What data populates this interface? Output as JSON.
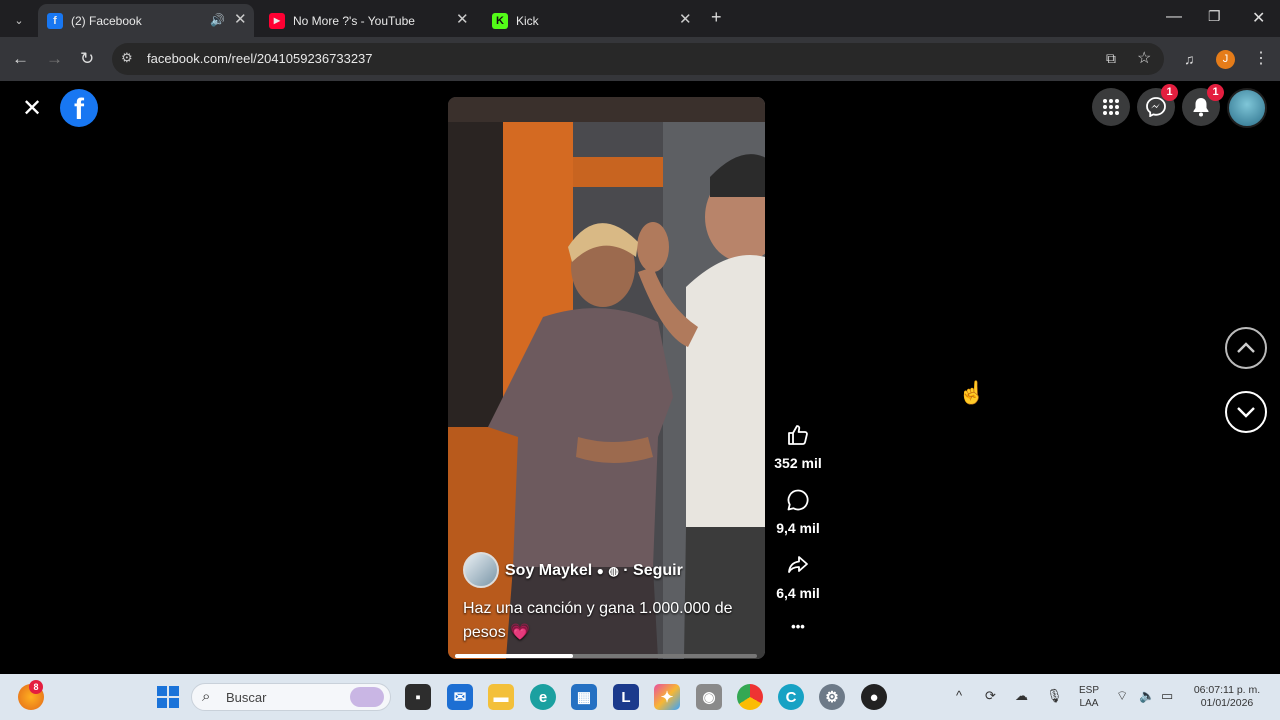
{
  "browser": {
    "tabs": [
      {
        "label": "(2) Facebook",
        "active": true
      },
      {
        "label": "No More ?'s - YouTube",
        "active": false
      },
      {
        "label": "Kick",
        "active": false
      }
    ],
    "url": "facebook.com/reel/2041059236733237",
    "profile_initial": "J"
  },
  "fb": {
    "messenger_badge": "1",
    "notifications_badge": "1"
  },
  "reel": {
    "author": "Soy Maykel",
    "follow_label": "Seguir",
    "caption": "Haz una canción y gana 1.000.000 de pesos 💗",
    "progress": 0.39,
    "likes": "352 mil",
    "comments": "9,4 mil",
    "shares": "6,4 mil",
    "more": "•••"
  },
  "taskbar": {
    "weather_badge": "8",
    "search_placeholder": "Buscar",
    "lang_line1": "ESP",
    "lang_line2": "LAA",
    "time": "06:07:11 p. m.",
    "date": "01/01/2026"
  },
  "colors": {
    "facebook_blue": "#1877f2",
    "badge_red": "#e41e3f",
    "chrome_dark": "#35363a"
  }
}
